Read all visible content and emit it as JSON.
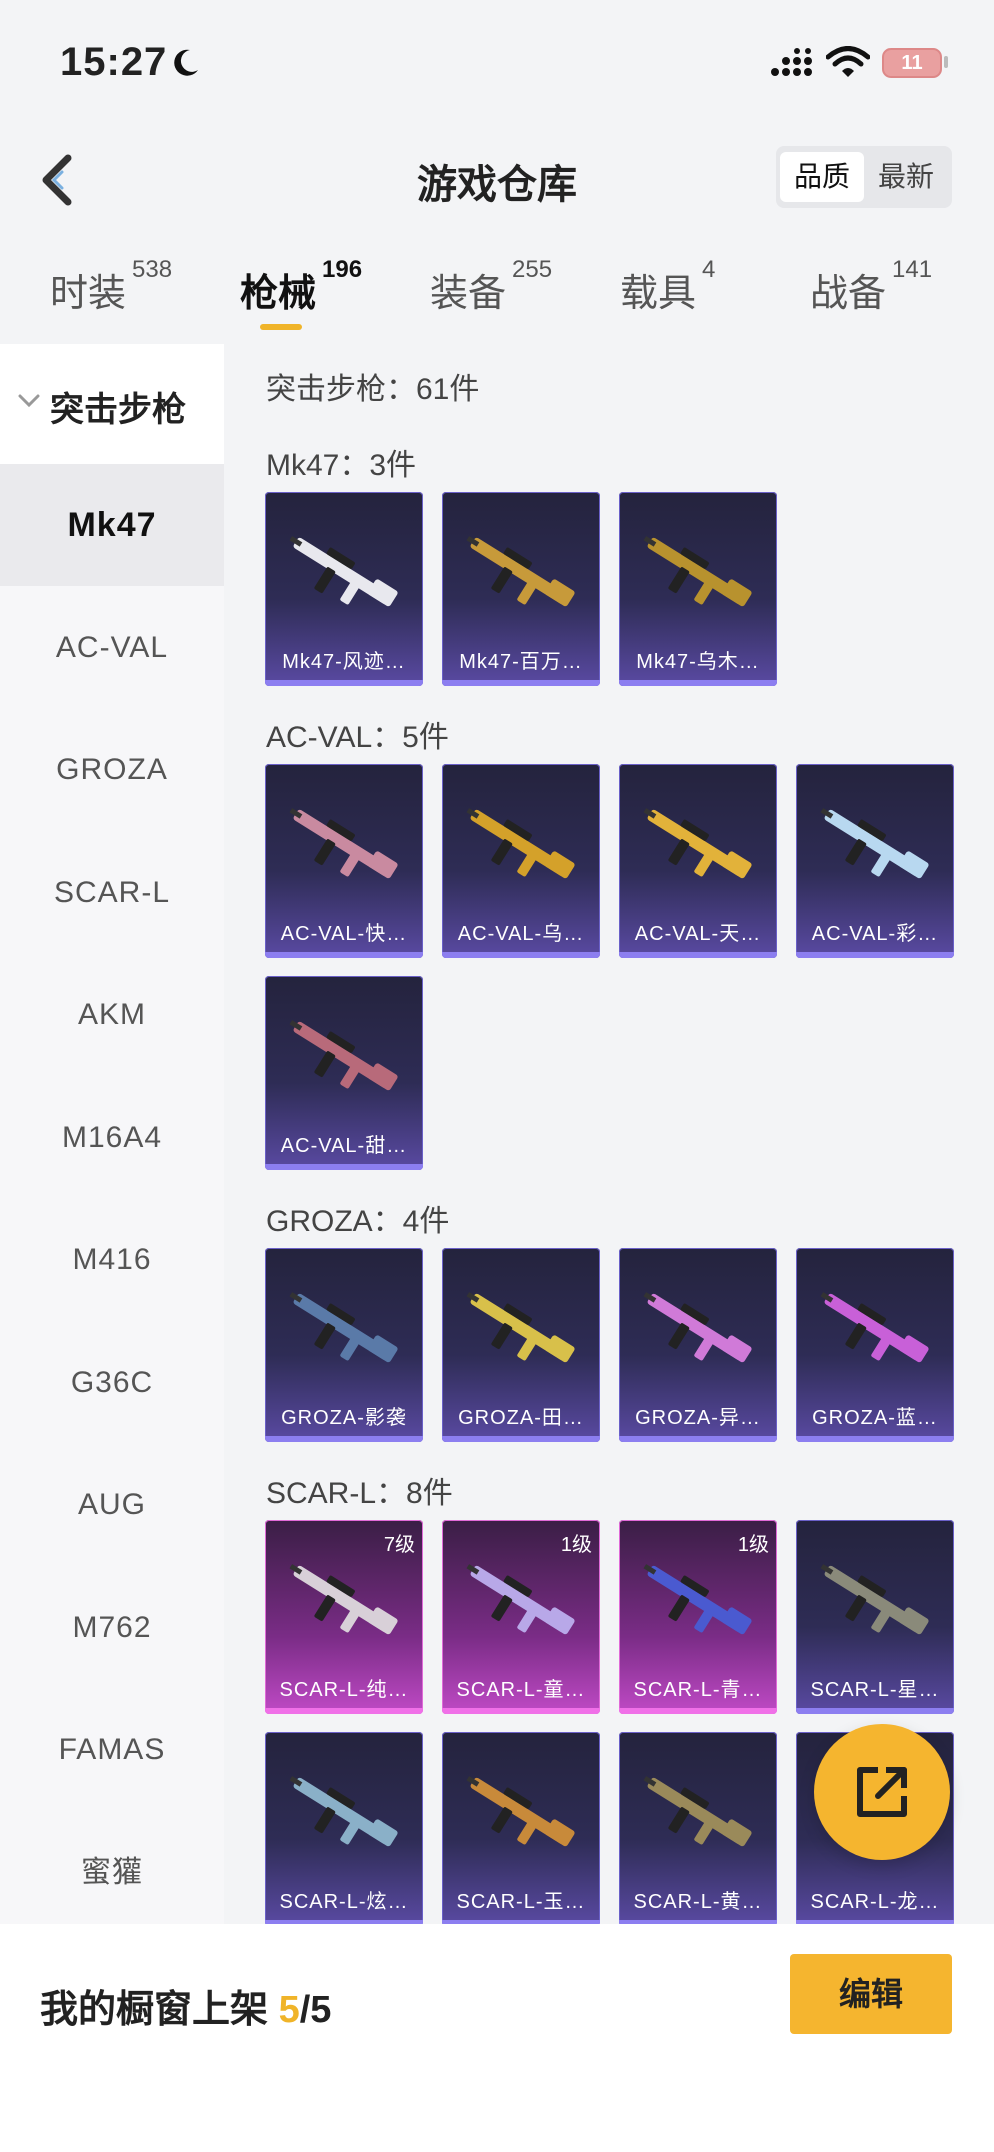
{
  "status": {
    "time": "15:27",
    "battery": "11"
  },
  "nav": {
    "title": "游戏仓库",
    "sort_quality": "品质",
    "sort_newest": "最新"
  },
  "tabs": [
    {
      "label": "时装",
      "count": "538"
    },
    {
      "label": "枪械",
      "count": "196"
    },
    {
      "label": "装备",
      "count": "255"
    },
    {
      "label": "载具",
      "count": "4"
    },
    {
      "label": "战备",
      "count": "141"
    }
  ],
  "sidebar": {
    "category": "突击步枪",
    "items": [
      "Mk47",
      "AC-VAL",
      "GROZA",
      "SCAR-L",
      "AKM",
      "M16A4",
      "M416",
      "G36C",
      "AUG",
      "M762",
      "FAMAS",
      "蜜獾"
    ]
  },
  "content": {
    "section_count": "突击步枪：61件",
    "groups": [
      {
        "title": "Mk47：3件",
        "cards": [
          {
            "name": "Mk47-风迹…",
            "color": "#e8e8ee"
          },
          {
            "name": "Mk47-百万…",
            "color": "#c79a3a"
          },
          {
            "name": "Mk47-乌木…",
            "color": "#b8922e"
          }
        ]
      },
      {
        "title": "AC-VAL：5件",
        "cards": [
          {
            "name": "AC-VAL-快…",
            "color": "#c98aa0"
          },
          {
            "name": "AC-VAL-乌…",
            "color": "#d4a12a"
          },
          {
            "name": "AC-VAL-天…",
            "color": "#e2b23a"
          },
          {
            "name": "AC-VAL-彩…",
            "color": "#b8d8f0"
          },
          {
            "name": "AC-VAL-甜…",
            "color": "#b86a7a"
          }
        ]
      },
      {
        "title": "GROZA：4件",
        "cards": [
          {
            "name": "GROZA-影袭",
            "color": "#5a7aa8"
          },
          {
            "name": "GROZA-田…",
            "color": "#d8c04a"
          },
          {
            "name": "GROZA-异…",
            "color": "#d07ad8"
          },
          {
            "name": "GROZA-蓝…",
            "color": "#c860d8"
          }
        ]
      },
      {
        "title": "SCAR-L：8件",
        "cards": [
          {
            "name": "SCAR-L-纯…",
            "level": "7级",
            "color": "#d8d0d8"
          },
          {
            "name": "SCAR-L-童…",
            "level": "1级",
            "color": "#b8a8e8"
          },
          {
            "name": "SCAR-L-青…",
            "level": "1级",
            "color": "#4a5ad0"
          },
          {
            "name": "SCAR-L-星…",
            "color": "#8a8a7a"
          },
          {
            "name": "SCAR-L-炫…",
            "color": "#8ab0c8"
          },
          {
            "name": "SCAR-L-玉…",
            "color": "#c88a3a"
          },
          {
            "name": "SCAR-L-黄…",
            "color": "#9a8a5a"
          },
          {
            "name": "SCAR-L-龙…",
            "color": "#8a6ac8"
          }
        ]
      }
    ]
  },
  "bottom": {
    "label": "我的橱窗上架 ",
    "shown": "5",
    "total": "/5",
    "edit": "编辑"
  }
}
